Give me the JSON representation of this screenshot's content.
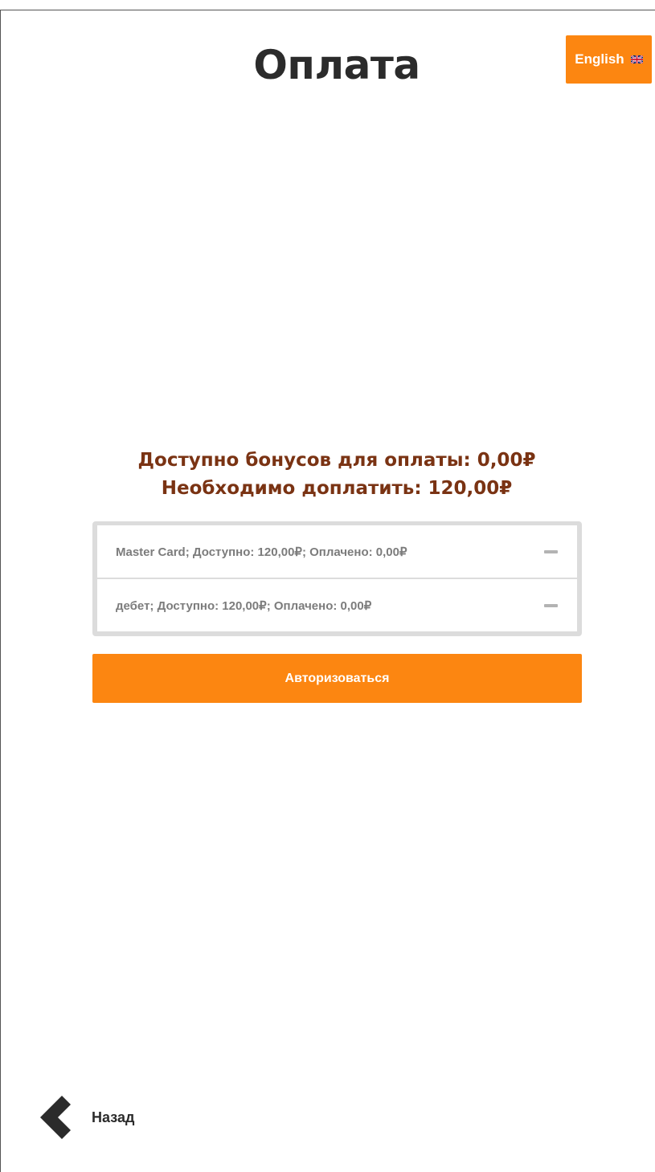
{
  "header": {
    "title": "Оплата",
    "language_button": {
      "label": "English",
      "icon": "uk-flag-icon"
    }
  },
  "summary": {
    "bonus_line": "Доступно бонусов для оплаты: 0,00₽",
    "due_line": "Необходимо доплатить: 120,00₽"
  },
  "payment_methods": [
    {
      "text": "Master Card; Доступно: 120,00₽; Оплачено: 0,00₽",
      "icon": "minus-icon"
    },
    {
      "text": "дебет; Доступно: 120,00₽; Оплачено: 0,00₽",
      "icon": "minus-icon"
    }
  ],
  "actions": {
    "authorize_label": "Авторизоваться"
  },
  "navigation": {
    "back_label": "Назад",
    "back_icon": "chevron-left-icon"
  },
  "colors": {
    "accent": "#fc8611",
    "summary_text": "#7a3313",
    "title_text": "#2b2b2b",
    "row_text": "#7c7c7c",
    "row_border": "#dcdcdc"
  }
}
